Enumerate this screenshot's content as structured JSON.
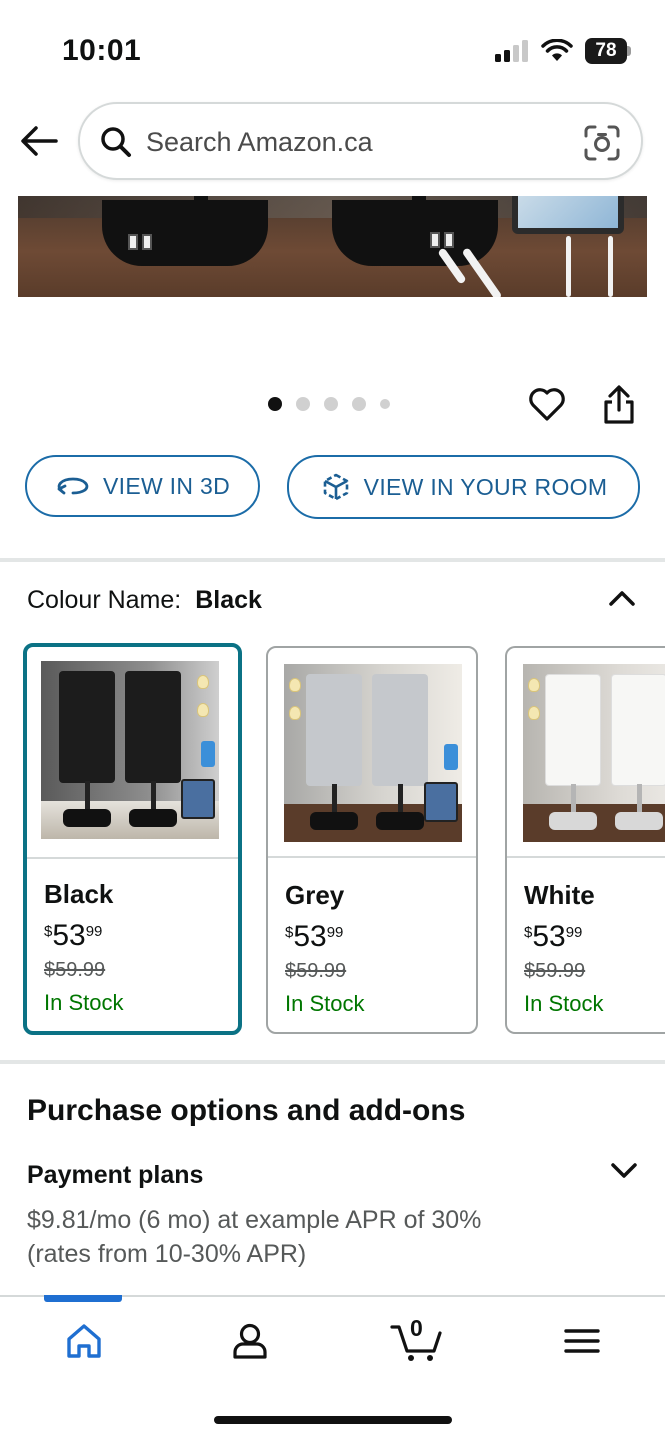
{
  "status_bar": {
    "time": "10:01",
    "battery": "78"
  },
  "header": {
    "search_placeholder": "Search Amazon.ca",
    "icons": [
      "back-arrow-icon",
      "search-icon",
      "camera-lens-icon"
    ]
  },
  "carousel": {
    "dot_count": 5,
    "active_index": 0
  },
  "actions": {
    "view_3d": "VIEW IN 3D",
    "view_room": "VIEW IN YOUR ROOM"
  },
  "colour": {
    "label": "Colour Name:",
    "selected": "Black",
    "options": [
      {
        "name": "Black",
        "currency": "$",
        "price_whole": "53",
        "price_fraction": "99",
        "list_price": "$59.99",
        "stock": "In Stock"
      },
      {
        "name": "Grey",
        "currency": "$",
        "price_whole": "53",
        "price_fraction": "99",
        "list_price": "$59.99",
        "stock": "In Stock"
      },
      {
        "name": "White",
        "currency": "$",
        "price_whole": "53",
        "price_fraction": "99",
        "list_price": "$59.99",
        "stock": "In Stock"
      }
    ]
  },
  "purchase": {
    "title": "Purchase options and add-ons",
    "plans_title": "Payment plans",
    "plans_description": "$9.81/mo (6 mo) at example APR of 30% (rates from 10-30% APR)"
  },
  "bottom_nav": {
    "cart_count": "0",
    "active": "home",
    "items": [
      "home-icon",
      "account-icon",
      "cart-icon",
      "menu-icon"
    ]
  },
  "colors": {
    "accent_blue": "#1b6ca8",
    "selected_border": "#0b7285",
    "in_stock_green": "#007600",
    "nav_indicator": "#1f6fd1"
  }
}
